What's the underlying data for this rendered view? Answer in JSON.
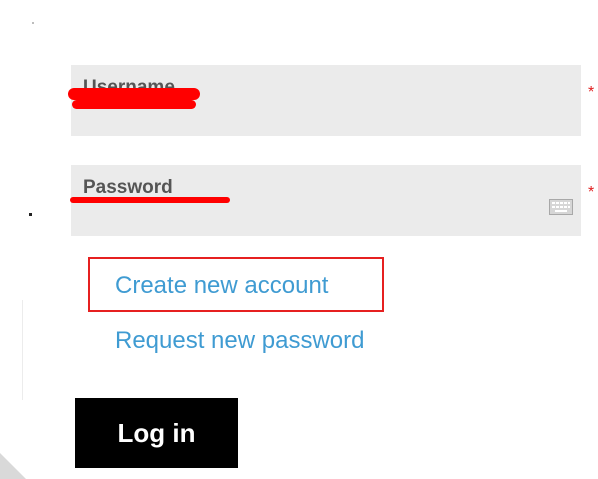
{
  "form": {
    "username": {
      "label": "Username",
      "required_marker": "*"
    },
    "password": {
      "label": "Password",
      "required_marker": "*",
      "keyboard_icon": "keyboard-icon"
    },
    "links": {
      "create_account": "Create new account",
      "request_password": "Request new password"
    },
    "login_label": "Log in"
  },
  "colors": {
    "field_bg": "#ebebeb",
    "link": "#3f9bd2",
    "required": "#e02020",
    "button_bg": "#000000",
    "button_text": "#ffffff",
    "highlight_border": "#e62020",
    "scribble": "#ff0000"
  }
}
